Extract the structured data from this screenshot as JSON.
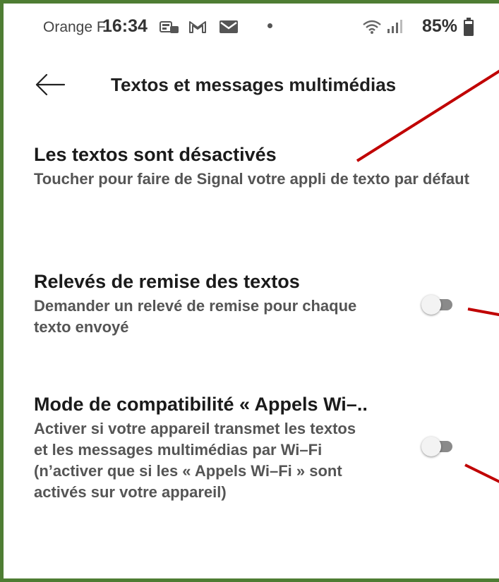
{
  "status_bar": {
    "carrier": "Orange F",
    "time": "16:34",
    "battery": "85%"
  },
  "app_bar": {
    "title": "Textos et messages multimédias"
  },
  "preferences": [
    {
      "title": "Les textos sont désactivés",
      "summary": "Toucher pour faire de Signal votre appli de texto par défaut"
    },
    {
      "title": "Relevés de remise des textos",
      "summary": "Demander un relevé de remise pour chaque texto envoyé",
      "toggle_on": false
    },
    {
      "title": "Mode de compatibilité « Appels Wi–..",
      "summary": "Activer si votre appareil transmet les textos et les messages multimédias par Wi–Fi (n’activer que si les « Appels Wi–Fi » sont activés sur votre appareil)",
      "toggle_on": false
    }
  ],
  "colors": {
    "frame": "#4e7d33",
    "annotation_arrow": "#c00000",
    "toggle_track_off": "#8a8a8a"
  }
}
